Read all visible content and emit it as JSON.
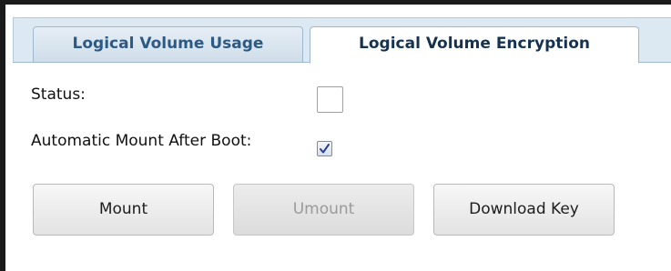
{
  "tabs": [
    {
      "label": "Logical Volume Usage",
      "active": false
    },
    {
      "label": "Logical Volume Encryption",
      "active": true
    }
  ],
  "form": {
    "status": {
      "label": "Status:",
      "checked": false
    },
    "auto_mount": {
      "label": "Automatic Mount After Boot:",
      "checked": true
    }
  },
  "buttons": {
    "mount": {
      "label": "Mount",
      "enabled": true
    },
    "umount": {
      "label": "Umount",
      "enabled": false
    },
    "download_key": {
      "label": "Download Key",
      "enabled": true
    }
  },
  "colors": {
    "tab_text": "#204870",
    "tab_strip": "#dce8f2",
    "checkmark": "#2a3f8f",
    "disabled_text": "#9a9a9a"
  },
  "icons": {
    "checkbox_checked": "checkmark-icon"
  }
}
